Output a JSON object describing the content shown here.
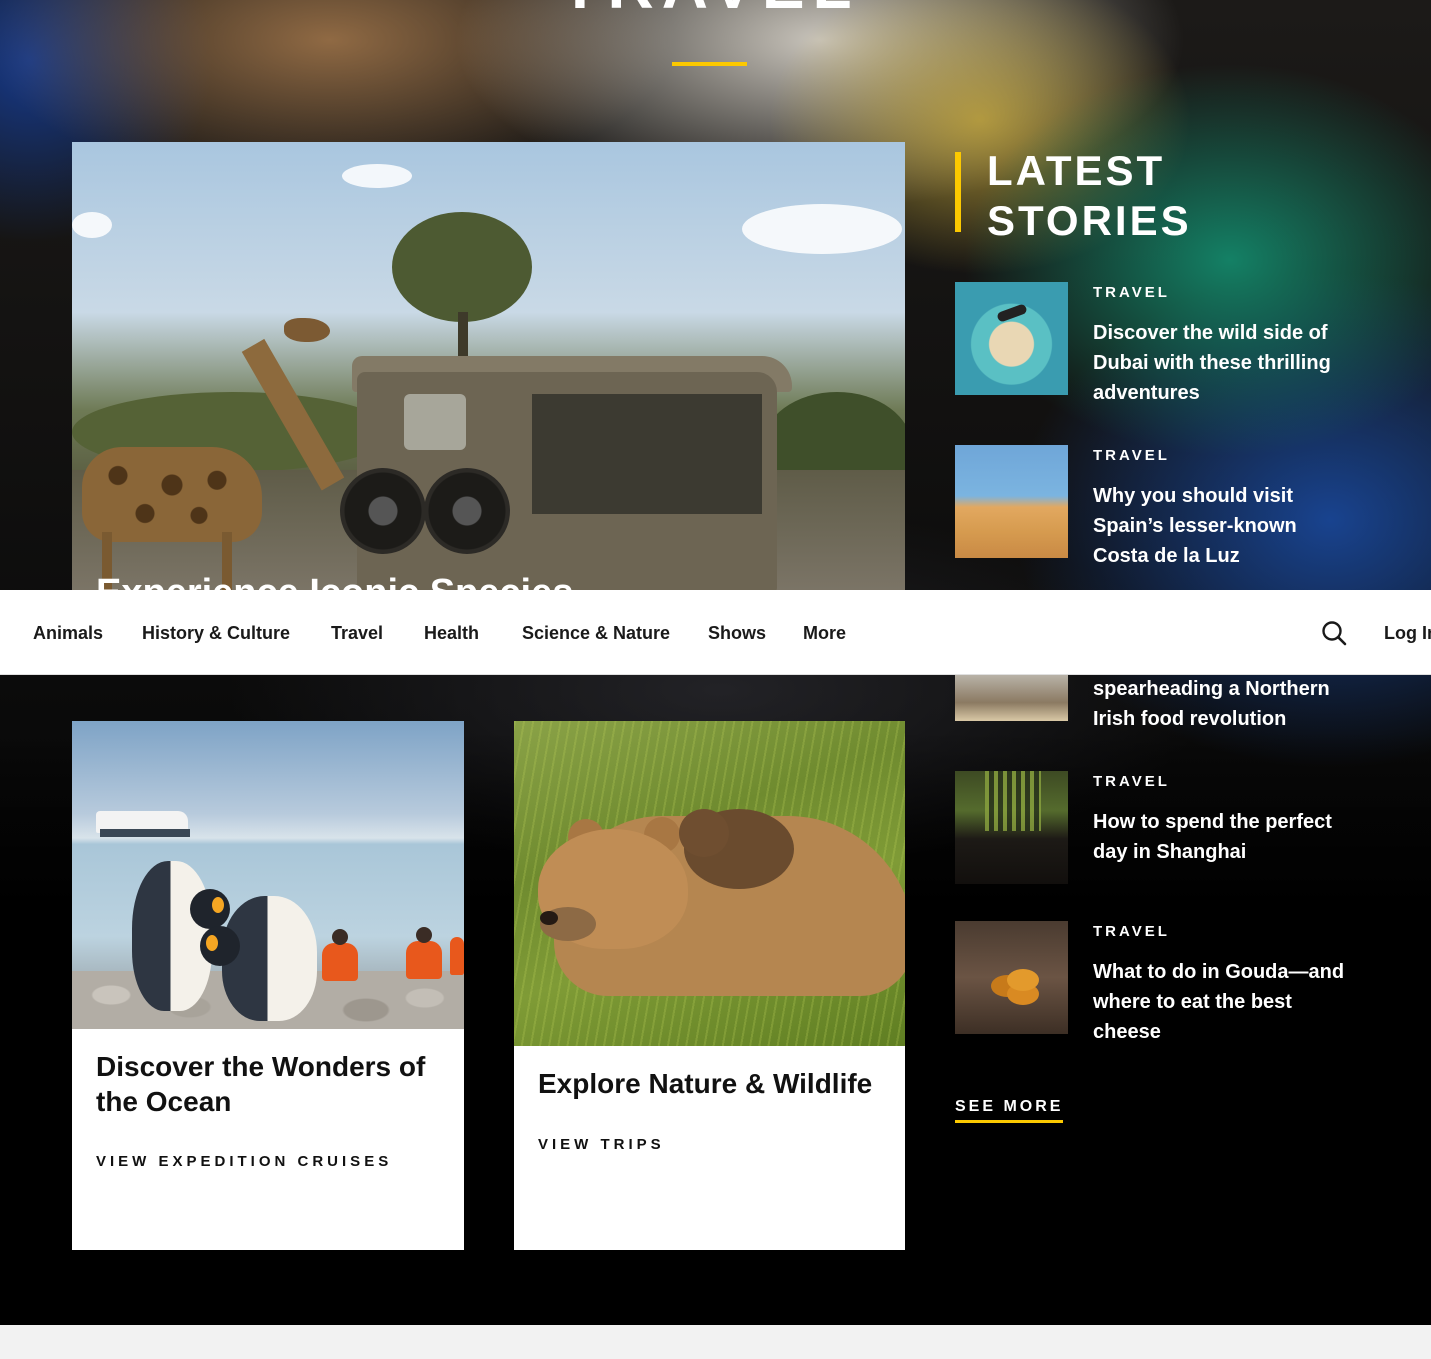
{
  "page": {
    "title": "TRAVEL"
  },
  "hero": {
    "headline": "Experience Iconic Species"
  },
  "nav": {
    "items": [
      "Animals",
      "History & Culture",
      "Travel",
      "Health",
      "Science & Nature",
      "Shows",
      "More"
    ],
    "search_icon": "search-icon",
    "login_label": "Log In"
  },
  "latest": {
    "title": "LATEST STORIES",
    "stories": [
      {
        "kicker": "TRAVEL",
        "headline": "Discover the wild side of Dubai with these thrilling adventures"
      },
      {
        "kicker": "TRAVEL",
        "headline": "Why you should visit Spain’s lesser-known Costa de la Luz"
      },
      {
        "kicker": "",
        "headline": "spearheading a Northern Irish food revolution"
      },
      {
        "kicker": "TRAVEL",
        "headline": "How to spend the perfect day in Shanghai"
      },
      {
        "kicker": "TRAVEL",
        "headline": "What to do in Gouda—and where to eat the best cheese"
      }
    ],
    "see_more": "SEE MORE"
  },
  "cards": [
    {
      "title": "Discover the Wonders of the Ocean",
      "cta": "VIEW EXPEDITION CRUISES"
    },
    {
      "title": "Explore Nature & Wildlife",
      "cta": "VIEW TRIPS"
    }
  ],
  "colors": {
    "accent": "#fcc900",
    "background": "#000000",
    "nav_background": "#ffffff",
    "footer_strip": "#f2f2f2"
  }
}
